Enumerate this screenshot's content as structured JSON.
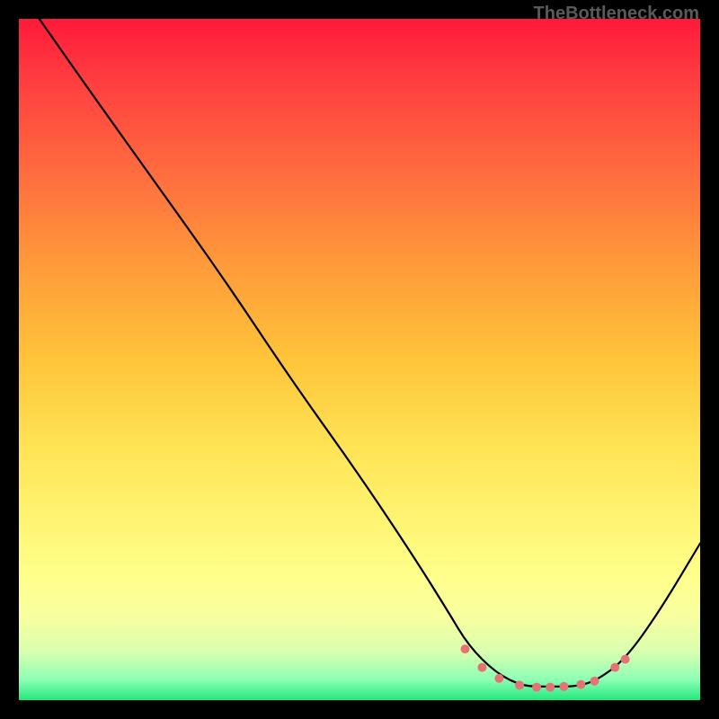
{
  "watermark": "TheBottleneck.com",
  "chart_data": {
    "type": "line",
    "title": "",
    "xlabel": "",
    "ylabel": "",
    "xlim": [
      0,
      100
    ],
    "ylim": [
      0,
      100
    ],
    "series": [
      {
        "name": "curve",
        "x": [
          3,
          10,
          20,
          30,
          40,
          50,
          58,
          63,
          66,
          70,
          74,
          78,
          82,
          85,
          89,
          94,
          100
        ],
        "y": [
          100,
          90,
          76,
          62,
          47,
          33,
          21,
          13,
          8,
          4,
          2,
          2,
          2,
          3,
          6,
          13,
          23
        ]
      }
    ],
    "markers": {
      "name": "dots",
      "color": "#e57373",
      "points": [
        {
          "x": 65.5,
          "y": 7.5
        },
        {
          "x": 68.0,
          "y": 4.8
        },
        {
          "x": 70.5,
          "y": 3.2
        },
        {
          "x": 73.5,
          "y": 2.2
        },
        {
          "x": 76.0,
          "y": 1.9
        },
        {
          "x": 78.0,
          "y": 1.9
        },
        {
          "x": 80.0,
          "y": 2.0
        },
        {
          "x": 82.5,
          "y": 2.3
        },
        {
          "x": 84.5,
          "y": 2.8
        },
        {
          "x": 87.5,
          "y": 4.8
        },
        {
          "x": 89.0,
          "y": 6.0
        }
      ]
    }
  }
}
